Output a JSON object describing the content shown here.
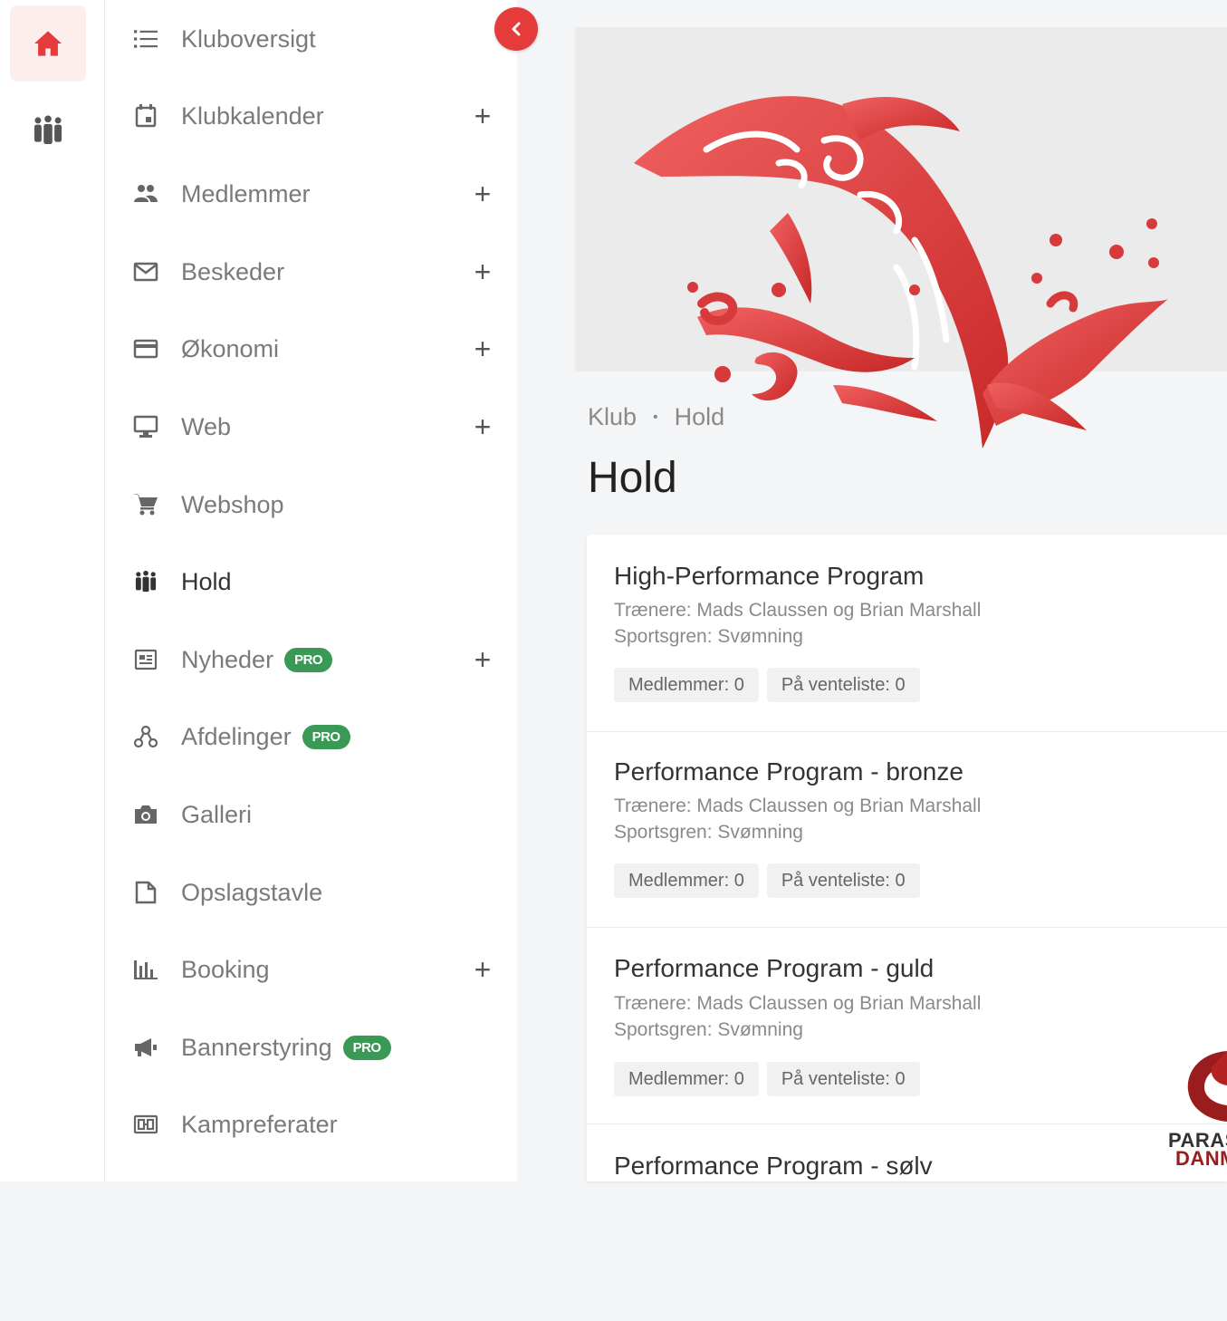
{
  "colors": {
    "accent": "#e53b3b",
    "pro_badge": "#3a9a55"
  },
  "rail": [
    {
      "icon": "home-icon",
      "active": true
    },
    {
      "icon": "teams-icon",
      "active": false
    }
  ],
  "sidebar": {
    "items": [
      {
        "label": "Kluboversigt",
        "icon": "list-icon",
        "plus": false
      },
      {
        "label": "Klubkalender",
        "icon": "calendar-icon",
        "plus": true
      },
      {
        "label": "Medlemmer",
        "icon": "people-icon",
        "plus": true
      },
      {
        "label": "Beskeder",
        "icon": "mail-icon",
        "plus": true
      },
      {
        "label": "Økonomi",
        "icon": "credit-card-icon",
        "plus": true
      },
      {
        "label": "Web",
        "icon": "monitor-icon",
        "plus": true
      },
      {
        "label": "Webshop",
        "icon": "cart-icon",
        "plus": false
      },
      {
        "label": "Hold",
        "icon": "teams-icon",
        "plus": false,
        "active": true
      },
      {
        "label": "Nyheder",
        "icon": "newspaper-icon",
        "plus": true,
        "pro": "PRO"
      },
      {
        "label": "Afdelinger",
        "icon": "hierarchy-icon",
        "plus": false,
        "pro": "PRO"
      },
      {
        "label": "Galleri",
        "icon": "camera-icon",
        "plus": false
      },
      {
        "label": "Opslagstavle",
        "icon": "note-icon",
        "plus": false
      },
      {
        "label": "Booking",
        "icon": "bar-chart-icon",
        "plus": true
      },
      {
        "label": "Bannerstyring",
        "icon": "megaphone-icon",
        "plus": false,
        "pro": "PRO"
      },
      {
        "label": "Kampreferater",
        "icon": "scoreboard-icon",
        "plus": false
      }
    ],
    "plus_symbol": "+"
  },
  "breadcrumb": {
    "root": "Klub",
    "separator": "•",
    "current": "Hold"
  },
  "page": {
    "title": "Hold"
  },
  "teams": [
    {
      "title": "High-Performance Program",
      "coaches": "Trænere: Mads Claussen og Brian Marshall",
      "sport": "Sportsgren: Svømning",
      "members": "Medlemmer: 0",
      "waitlist": "På venteliste: 0"
    },
    {
      "title": "Performance Program - bronze",
      "coaches": "Trænere: Mads Claussen og Brian Marshall",
      "sport": "Sportsgren: Svømning",
      "members": "Medlemmer: 0",
      "waitlist": "På venteliste: 0"
    },
    {
      "title": "Performance Program - guld",
      "coaches": "Trænere: Mads Claussen og Brian Marshall",
      "sport": "Sportsgren: Svømning",
      "members": "Medlemmer: 0",
      "waitlist": "På venteliste: 0"
    },
    {
      "title": "Performance Program - sølv"
    }
  ],
  "footer_logo": {
    "line1": "PARAS",
    "line2": "DANM"
  }
}
